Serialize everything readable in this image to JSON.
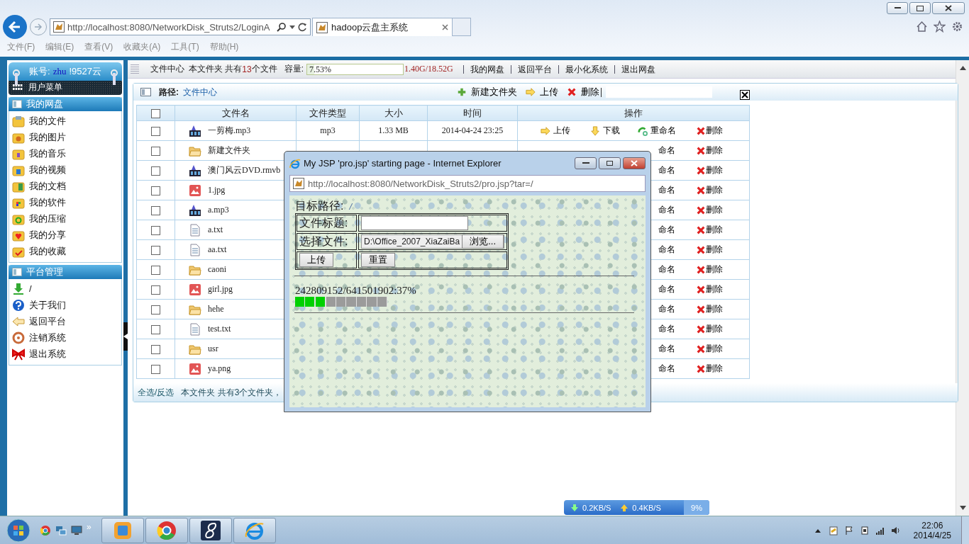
{
  "browser": {
    "url": "http://localhost:8080/NetworkDisk_Struts2/LoginA",
    "tab_title": "hadoop云盘主系统",
    "menu": [
      "文件(F)",
      "编辑(E)",
      "查看(V)",
      "收藏夹(A)",
      "工具(T)",
      "帮助(H)"
    ]
  },
  "topbar": {
    "title": "文件中心",
    "count_prefix": "本文件夹 共有",
    "count": "13",
    "count_suffix": "个文件",
    "capacity_label": "容量:",
    "capacity": {
      "level": 0.0753,
      "reading": "7.53%"
    },
    "usage": "1.40G/18.52G",
    "links": [
      "我的网盘",
      "返回平台",
      "最小化系统",
      "退出网盘"
    ]
  },
  "sidebar": {
    "account_label": "账号:",
    "account_user": "zhu",
    "account_suffix": "!9527云",
    "menu_title": "用户菜单",
    "sections": [
      {
        "title": "我的网盘",
        "items": [
          {
            "label": "我的文件",
            "kind": "folder"
          },
          {
            "label": "我的图片",
            "kind": "picture"
          },
          {
            "label": "我的音乐",
            "kind": "music"
          },
          {
            "label": "我的视频",
            "kind": "video"
          },
          {
            "label": "我的文档",
            "kind": "document"
          },
          {
            "label": "我的软件",
            "kind": "software"
          },
          {
            "label": "我的压缩",
            "kind": "archive"
          },
          {
            "label": "我的分享",
            "kind": "share"
          },
          {
            "label": "我的收藏",
            "kind": "favorite"
          }
        ]
      },
      {
        "title": "平台管理",
        "items": [
          {
            "label": "/",
            "kind": "download"
          },
          {
            "label": "关于我们",
            "kind": "help"
          },
          {
            "label": "返回平台",
            "kind": "back"
          },
          {
            "label": "注销系统",
            "kind": "logout"
          },
          {
            "label": "退出系统",
            "kind": "exit"
          }
        ]
      }
    ]
  },
  "file_panel": {
    "path_label": "路径:",
    "path": "文件中心",
    "actions": [
      {
        "kind": "new_folder",
        "label": "新建文件夹"
      },
      {
        "kind": "upload",
        "label": "上传"
      },
      {
        "kind": "delete",
        "label": "删除"
      }
    ],
    "select_all_checkbox": {
      "checked": false
    },
    "columns": [
      "文件名",
      "文件类型",
      "大小",
      "时间",
      "操作"
    ],
    "rows": [
      {
        "checked": false,
        "name": "一剪梅.mp3",
        "kind": "video",
        "type": "mp3",
        "size": "1.33 MB",
        "time": "2014-04-24 23:25",
        "ops": [
          {
            "kind": "upload",
            "label": "上传"
          },
          {
            "kind": "download",
            "label": "下载"
          },
          {
            "kind": "rename",
            "label": "重命名"
          },
          {
            "kind": "delete",
            "label": "删除"
          }
        ]
      },
      {
        "checked": false,
        "name": "新建文件夹",
        "kind": "folder",
        "ops": [
          {
            "kind": "rename_partial",
            "label": "命名"
          },
          {
            "kind": "delete",
            "label": "删除"
          }
        ]
      },
      {
        "checked": false,
        "name": "澳门风云DVD.rmvb",
        "kind": "video",
        "ops": [
          {
            "kind": "rename_partial",
            "label": "命名"
          },
          {
            "kind": "delete",
            "label": "删除"
          }
        ]
      },
      {
        "checked": false,
        "name": "1.jpg",
        "kind": "image",
        "ops": [
          {
            "kind": "rename_partial",
            "label": "命名"
          },
          {
            "kind": "delete",
            "label": "删除"
          }
        ]
      },
      {
        "checked": false,
        "name": "a.mp3",
        "kind": "video",
        "ops": [
          {
            "kind": "rename_partial",
            "label": "命名"
          },
          {
            "kind": "delete",
            "label": "删除"
          }
        ]
      },
      {
        "checked": false,
        "name": "a.txt",
        "kind": "text",
        "ops": [
          {
            "kind": "rename_partial",
            "label": "命名"
          },
          {
            "kind": "delete",
            "label": "删除"
          }
        ]
      },
      {
        "checked": false,
        "name": "aa.txt",
        "kind": "text",
        "ops": [
          {
            "kind": "rename_partial",
            "label": "命名"
          },
          {
            "kind": "delete",
            "label": "删除"
          }
        ]
      },
      {
        "checked": false,
        "name": "caoni",
        "kind": "folder",
        "ops": [
          {
            "kind": "rename_partial",
            "label": "命名"
          },
          {
            "kind": "delete",
            "label": "删除"
          }
        ]
      },
      {
        "checked": false,
        "name": "girl.jpg",
        "kind": "image",
        "ops": [
          {
            "kind": "rename_partial",
            "label": "命名"
          },
          {
            "kind": "delete",
            "label": "删除"
          }
        ]
      },
      {
        "checked": false,
        "name": "hehe",
        "kind": "folder",
        "ops": [
          {
            "kind": "rename_partial",
            "label": "命名"
          },
          {
            "kind": "delete",
            "label": "删除"
          }
        ]
      },
      {
        "checked": false,
        "name": "test.txt",
        "kind": "text",
        "ops": [
          {
            "kind": "rename_partial",
            "label": "命名"
          },
          {
            "kind": "delete",
            "label": "删除"
          }
        ]
      },
      {
        "checked": false,
        "name": "usr",
        "kind": "folder",
        "ops": [
          {
            "kind": "rename_partial",
            "label": "命名"
          },
          {
            "kind": "delete",
            "label": "删除"
          }
        ]
      },
      {
        "checked": false,
        "name": "ya.png",
        "kind": "image",
        "ops": [
          {
            "kind": "rename_partial",
            "label": "命名"
          },
          {
            "kind": "delete",
            "label": "删除"
          }
        ]
      }
    ],
    "footer": {
      "select_all": "全选/反选",
      "summary": "本文件夹 共有3个文件夹，"
    }
  },
  "popup": {
    "title": "My JSP 'pro.jsp' starting page - Internet Explorer",
    "url": "http://localhost:8080/NetworkDisk_Struts2/pro.jsp?tar=/",
    "target_label": "目标路径:",
    "target": "/",
    "title_label": "文件标题:",
    "file_label": "选择文件:",
    "file_value": "D:\\Office_2007_XiaZaiBa",
    "browse": "浏览...",
    "upload": "上传",
    "reset": "重置",
    "progress_text": "242809152/641501902:37%",
    "progress": {
      "level": 0.37
    }
  },
  "speed_widget": {
    "down": "0.2KB/S",
    "up": "0.4KB/S",
    "percent": "9%"
  },
  "taskbar": {
    "quick_more": "»",
    "time": "22:06",
    "date": "2014/4/25"
  }
}
